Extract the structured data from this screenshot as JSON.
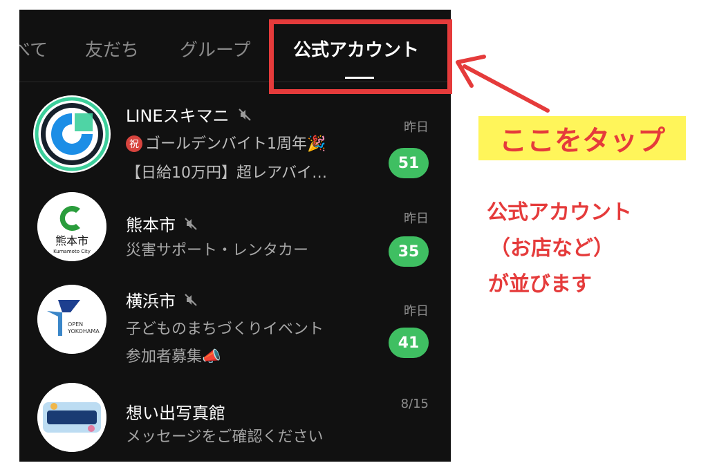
{
  "tabs": [
    {
      "label": "べて"
    },
    {
      "label": "友だち"
    },
    {
      "label": "グループ"
    },
    {
      "label": "公式アカウント"
    }
  ],
  "active_tab_index": 3,
  "chats": [
    {
      "name": "LINEスキマニ",
      "muted": true,
      "line1_badge": "祝",
      "line1": "ゴールデンバイト1周年🎉",
      "line2": "【日給10万円】超レアバイ…",
      "time": "昨日",
      "unread": "51",
      "avatar_icon": "skimani-logo-icon"
    },
    {
      "name": "熊本市",
      "muted": true,
      "line1": "災害サポート・レンタカー",
      "time": "昨日",
      "unread": "35",
      "avatar_text": "熊本市",
      "avatar_sub": "Kumamoto City",
      "avatar_icon": "kumamoto-logo-icon"
    },
    {
      "name": "横浜市",
      "muted": true,
      "line1": "子どものまちづくりイベント",
      "line2": "参加者募集📣",
      "time": "昨日",
      "unread": "41",
      "avatar_text1": "OPEN",
      "avatar_text2": "YOKOHAMA",
      "avatar_icon": "yokohama-logo-icon"
    },
    {
      "name": "想い出写真館",
      "muted": false,
      "line1": "メッセージをご確認ください",
      "time": "8/15",
      "avatar_icon": "omoide-logo-icon"
    }
  ],
  "annotation": {
    "tap_label": "ここをタップ",
    "caption_l1": "公式アカウント",
    "caption_l2": "（お店など）",
    "caption_l3": "が並びます"
  },
  "colors": {
    "accent_red": "#e53b3b",
    "highlight_yellow": "#fff55a",
    "badge_green": "#3fbf62",
    "panel_bg": "#111111"
  }
}
